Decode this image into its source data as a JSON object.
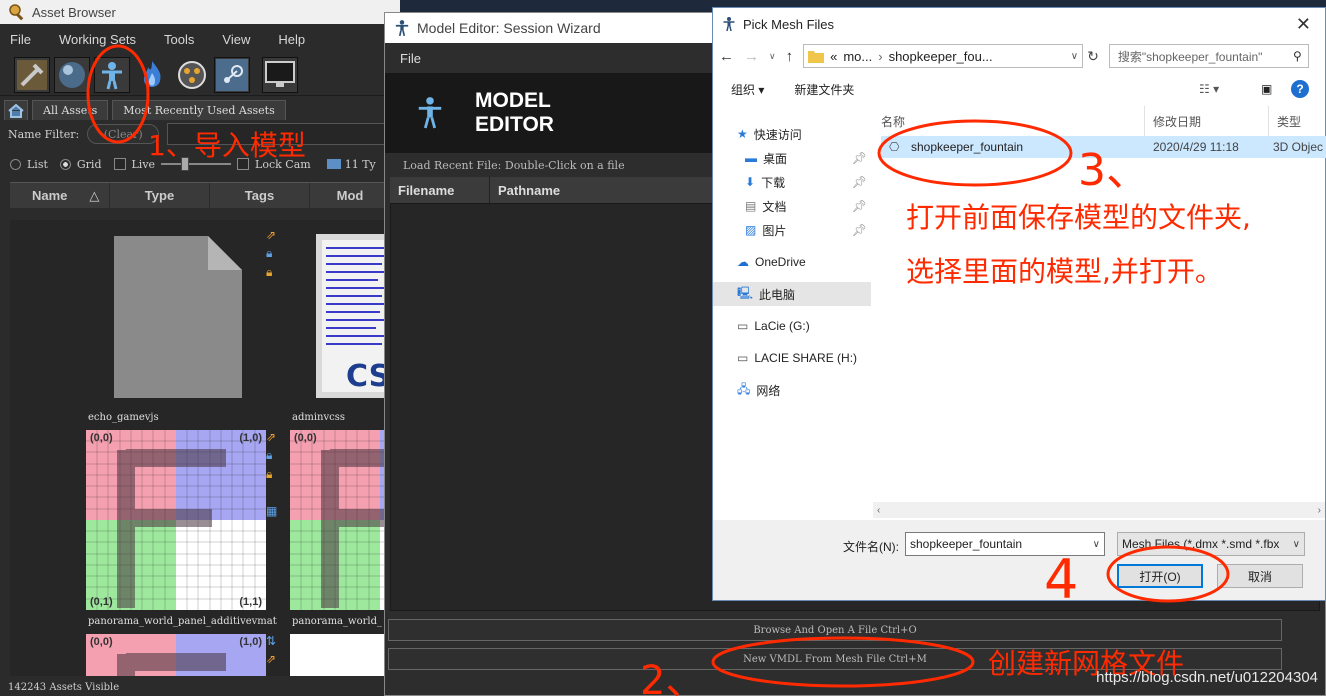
{
  "asset_browser": {
    "title": "Asset Browser",
    "menu": [
      "File",
      "Working Sets",
      "Tools",
      "View",
      "Help"
    ],
    "toolbar_icons": [
      "grid-hammer-icon",
      "sphere-icon",
      "model-figure-icon",
      "fire-icon",
      "film-reel-icon",
      "steam-icon",
      "monitor-icon"
    ],
    "tabs": [
      "All Assets",
      "Most Recently Used Assets"
    ],
    "name_filter_label": "Name Filter:",
    "clear_label": "(Clear)",
    "view_options": [
      "List",
      "Grid",
      "Live"
    ],
    "view_selected": "Grid",
    "lock_cam_label": "Lock Cam",
    "type_count_label": "11 Ty",
    "columns": [
      "Name",
      "Type",
      "Tags",
      "Mod"
    ],
    "assets": [
      "echo_gamevjs",
      "adminvcss",
      "panorama_world_panel_additivevmat",
      "panorama_world_"
    ],
    "tex_labels": {
      "tl": "(0,0)",
      "tr": "(1,0)",
      "bl": "(0,1)",
      "br": "(1,1)"
    },
    "status": "142243 Assets Visible"
  },
  "model_editor": {
    "title": "Model Editor: Session Wizard",
    "menu": [
      "File"
    ],
    "brand_line1": "MODEL",
    "brand_line2": "EDITOR",
    "recent_label": "Load Recent File: Double-Click on a file",
    "columns": [
      "Filename",
      "Pathname"
    ],
    "browse_button": "Browse And Open A File Ctrl+O",
    "new_vmdl_button": "New VMDL From Mesh File Ctrl+M"
  },
  "pick_mesh": {
    "title": "Pick Mesh Files",
    "breadcrumb": [
      "«",
      "mo...",
      "›",
      "shopkeeper_fou..."
    ],
    "search_placeholder": "搜索\"shopkeeper_fountain\"",
    "organize": "组织 ▾",
    "new_folder": "新建文件夹",
    "nav_items": [
      {
        "label": "快速访问",
        "icon": "star-icon"
      },
      {
        "label": "桌面",
        "icon": "desktop-icon"
      },
      {
        "label": "下载",
        "icon": "download-icon"
      },
      {
        "label": "文档",
        "icon": "document-icon"
      },
      {
        "label": "图片",
        "icon": "picture-icon"
      },
      {
        "label": "OneDrive",
        "icon": "cloud-icon"
      },
      {
        "label": "此电脑",
        "icon": "computer-icon"
      },
      {
        "label": "LaCie (G:)",
        "icon": "drive-icon"
      },
      {
        "label": "LACIE SHARE (H:)",
        "icon": "drive-icon"
      },
      {
        "label": "网络",
        "icon": "network-icon"
      }
    ],
    "columns": [
      "名称",
      "修改日期",
      "类型"
    ],
    "file": {
      "name": "shopkeeper_fountain",
      "date": "2020/4/29 11:18",
      "type": "3D Objec"
    },
    "filename_label": "文件名(N):",
    "filename_value": "shopkeeper_fountain",
    "filter_value": "Mesh Files (*.dmx *.smd *.fbx",
    "open_button": "打开(O)",
    "cancel_button": "取消"
  },
  "annotations": {
    "step1": "1、导入模型",
    "step2_num": "2、",
    "step2": "创建新网格文件",
    "step3": "3、",
    "step3_line1": "打开前面保存模型的文件夹,",
    "step3_line2": "选择里面的模型,并打开。",
    "step4": "4"
  },
  "watermark": "https://blog.csdn.net/u012204304",
  "colors": {
    "annotation": "#ff2a00",
    "selection": "#cce8ff",
    "primary_border": "#0078d7"
  }
}
